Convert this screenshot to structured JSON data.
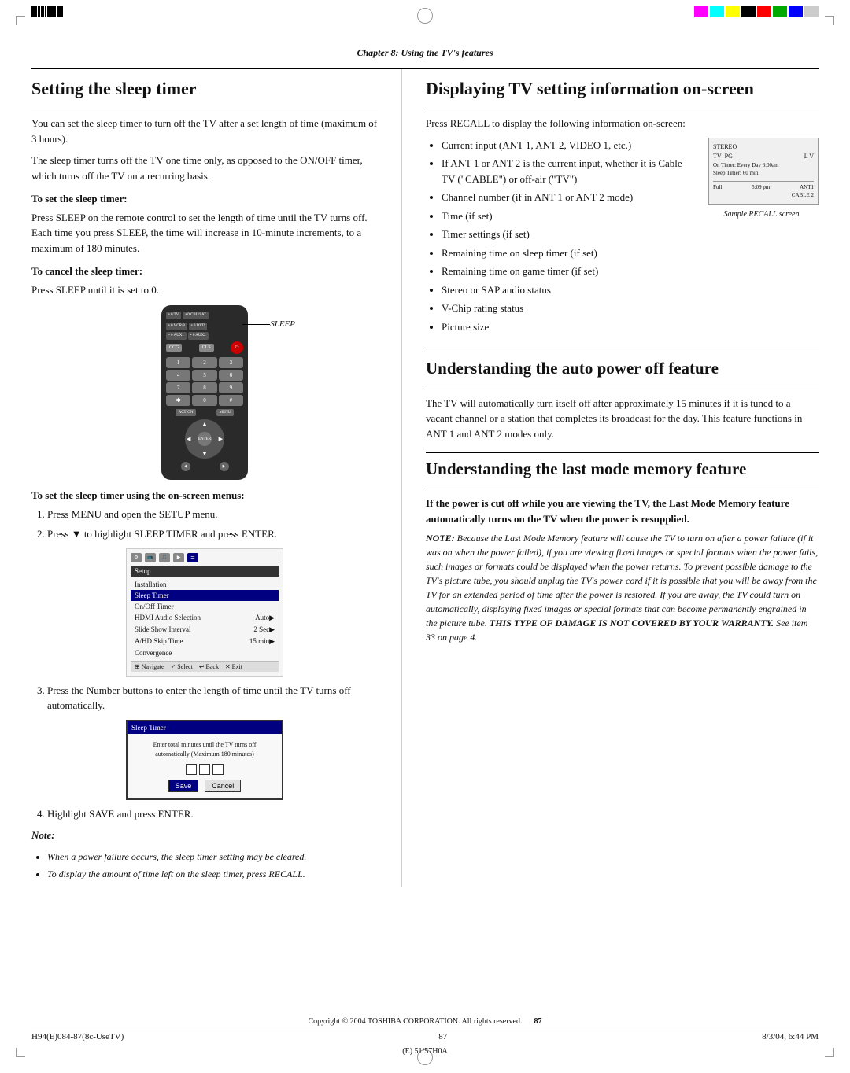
{
  "page": {
    "chapter_header": "Chapter 8: Using the TV's features",
    "page_number": "87",
    "copyright": "Copyright © 2004 TOSHIBA CORPORATION. All rights reserved.",
    "footer_left": "H94(E)084-87(8c-UseTV)",
    "footer_center": "87",
    "footer_right": "8/3/04, 6:44 PM",
    "model": "(E) 51/57H0A"
  },
  "left_column": {
    "section_title": "Setting the sleep timer",
    "intro_para1": "You can set the sleep timer to turn off the TV after a set length of time (maximum of 3 hours).",
    "intro_para2": "The sleep timer turns off the TV one time only, as opposed to the ON/OFF timer, which turns off the TV on a recurring basis.",
    "set_heading": "To set the sleep timer:",
    "set_para": "Press SLEEP on the remote control to set the length of time until the TV turns off. Each time you press SLEEP, the time will increase in 10-minute increments, to a maximum of 180 minutes.",
    "cancel_heading": "To cancel the sleep timer:",
    "cancel_para": "Press SLEEP until it is set to 0.",
    "sleep_label": "SLEEP",
    "onscreen_heading": "To set the sleep timer using the on-screen menus:",
    "steps": [
      "Press MENU and open the SETUP menu.",
      "Press ▼ to highlight SLEEP TIMER and press ENTER.",
      "Press the Number buttons to enter the length of time until the TV turns off automatically.",
      "Highlight SAVE and press ENTER."
    ],
    "setup_menu": {
      "title": "Setup",
      "items": [
        {
          "label": "Installation",
          "value": ""
        },
        {
          "label": "Sleep Timer",
          "value": "",
          "highlighted": true
        },
        {
          "label": "On/Off Timer",
          "value": ""
        },
        {
          "label": "HDMI Audio Selection",
          "value": "Auto▶"
        },
        {
          "label": "Slide Show Interval",
          "value": "2 Sec▶"
        },
        {
          "label": "A/HD Skip Time",
          "value": "15 min▶"
        },
        {
          "label": "Convergence",
          "value": ""
        }
      ],
      "nav": [
        "Navigate",
        "Select",
        "Back",
        "Exit"
      ]
    },
    "sleep_timer_dialog": {
      "title": "Sleep Timer",
      "instruction": "Enter total minutes until the TV turns off automatically (Maximum 180 minutes)",
      "save_btn": "Save",
      "cancel_btn": "Cancel"
    },
    "note_heading": "Note:",
    "note_bullets": [
      "When a power failure occurs, the sleep timer setting may be cleared.",
      "To display the amount of time left on the sleep timer, press RECALL."
    ]
  },
  "right_column": {
    "display_section": {
      "title": "Displaying TV setting information on-screen",
      "intro": "Press RECALL to display the following information on-screen:",
      "bullets": [
        "Current input (ANT 1, ANT 2, VIDEO 1, etc.)",
        "If ANT 1 or ANT 2 is the current input, whether it is Cable TV (\"CABLE\") or off-air (\"TV\")",
        "Channel number (if in ANT 1 or ANT 2 mode)",
        "Time (if set)",
        "Timer settings (if set)",
        "Remaining time on sleep timer (if set)",
        "Remaining time on game timer (if set)",
        "Stereo or SAP audio status",
        "V-Chip rating status",
        "Picture size"
      ],
      "recall_screen": {
        "row1_left": "STEREO",
        "row1_right": "",
        "row2_left": "TV–PG",
        "row2_right": "L    V",
        "row3": "On Timer: Every Day 6:00am",
        "row4": "Sleep Timer: 60 min.",
        "row5_left": "Full",
        "row5_center": "5:09 pm",
        "row5_right": "ANT1",
        "row6_right": "CABLE 2"
      },
      "recall_caption": "Sample RECALL screen"
    },
    "auto_power_section": {
      "title": "Understanding the auto power off feature",
      "para": "The TV will automatically turn itself off after approximately 15 minutes if it is tuned to a vacant channel or a station that completes its broadcast for the day. This feature functions in ANT 1 and ANT 2 modes only."
    },
    "last_mode_section": {
      "title": "Understanding the last mode memory feature",
      "bold_para": "If the power is cut off while you are viewing the TV, the Last Mode Memory feature automatically turns on the TV when the power is resupplied.",
      "note_intro": "NOTE:",
      "note_text": "Because the Last Mode Memory feature will cause the TV to turn on after a power failure (if it was on when the power failed), if you are viewing fixed images or special formats when the power fails, such images or formats could be displayed when the power returns. To prevent possible damage to the TV's picture tube, you should unplug the TV's power cord if it is possible that you will be away from the TV for an extended period of time after the power is restored. If you are away, the TV could turn on automatically, displaying fixed images or special formats that can become permanently engrained in the picture tube.",
      "note_caps": "THIS TYPE OF DAMAGE IS NOT COVERED BY YOUR WARRANTY.",
      "note_end": "See item 33 on page 4."
    }
  }
}
